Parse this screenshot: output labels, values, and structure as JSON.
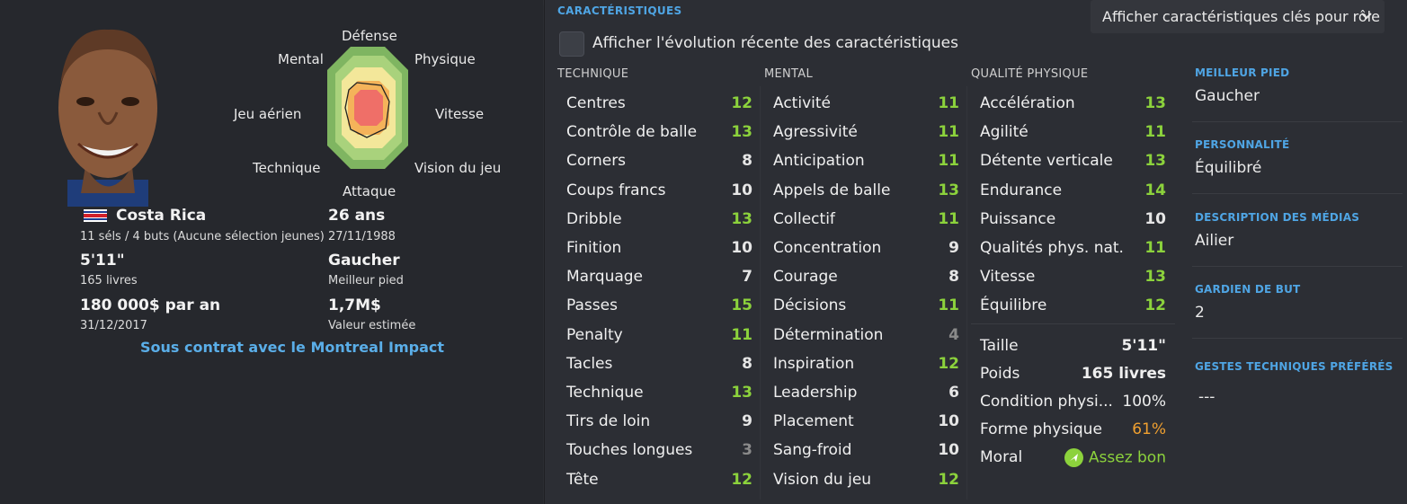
{
  "radar": {
    "labels": {
      "defense": "Défense",
      "physique": "Physique",
      "vitesse": "Vitesse",
      "vision": "Vision du jeu",
      "attaque": "Attaque",
      "technique": "Technique",
      "jeu_aerien": "Jeu aérien",
      "mental": "Mental"
    }
  },
  "player": {
    "nation": "Costa Rica",
    "caps": "11 séls / 4 buts (Aucune sélection jeunes)",
    "age": "26 ans",
    "birthdate": "27/11/1988",
    "height": "5'11\"",
    "weight": "165 livres",
    "foot": "Gaucher",
    "foot_label": "Meilleur pied",
    "wage": "180 000$ par an",
    "contract_end": "31/12/2017",
    "value": "1,7M$",
    "value_label": "Valeur estimée",
    "contract": "Sous contrat avec le Montreal Impact"
  },
  "header": {
    "section_title": "CARACTÉRISTIQUES",
    "dropdown": "Afficher caractéristiques clés pour rôle",
    "checkbox_label": "Afficher l'évolution récente des caractéristiques"
  },
  "columns": {
    "technique": "TECHNIQUE",
    "mental": "MENTAL",
    "physique": "QUALITÉ PHYSIQUE"
  },
  "technique": [
    {
      "name": "Centres",
      "value": "12",
      "color": "#8cd23c"
    },
    {
      "name": "Contrôle de balle",
      "value": "13",
      "color": "#8cd23c"
    },
    {
      "name": "Corners",
      "value": "8",
      "color": "#e6e6e6"
    },
    {
      "name": "Coups francs",
      "value": "10",
      "color": "#e6e6e6"
    },
    {
      "name": "Dribble",
      "value": "13",
      "color": "#8cd23c"
    },
    {
      "name": "Finition",
      "value": "10",
      "color": "#e6e6e6"
    },
    {
      "name": "Marquage",
      "value": "7",
      "color": "#e6e6e6"
    },
    {
      "name": "Passes",
      "value": "15",
      "color": "#8cd23c"
    },
    {
      "name": "Penalty",
      "value": "11",
      "color": "#8cd23c"
    },
    {
      "name": "Tacles",
      "value": "8",
      "color": "#e6e6e6"
    },
    {
      "name": "Technique",
      "value": "13",
      "color": "#8cd23c"
    },
    {
      "name": "Tirs de loin",
      "value": "9",
      "color": "#e6e6e6"
    },
    {
      "name": "Touches longues",
      "value": "3",
      "color": "#8a8a8a"
    },
    {
      "name": "Tête",
      "value": "12",
      "color": "#8cd23c"
    }
  ],
  "mental": [
    {
      "name": "Activité",
      "value": "11",
      "color": "#8cd23c"
    },
    {
      "name": "Agressivité",
      "value": "11",
      "color": "#8cd23c"
    },
    {
      "name": "Anticipation",
      "value": "11",
      "color": "#8cd23c"
    },
    {
      "name": "Appels de balle",
      "value": "13",
      "color": "#8cd23c"
    },
    {
      "name": "Collectif",
      "value": "11",
      "color": "#8cd23c"
    },
    {
      "name": "Concentration",
      "value": "9",
      "color": "#e6e6e6"
    },
    {
      "name": "Courage",
      "value": "8",
      "color": "#e6e6e6"
    },
    {
      "name": "Décisions",
      "value": "11",
      "color": "#8cd23c"
    },
    {
      "name": "Détermination",
      "value": "4",
      "color": "#8a8a8a"
    },
    {
      "name": "Inspiration",
      "value": "12",
      "color": "#8cd23c"
    },
    {
      "name": "Leadership",
      "value": "6",
      "color": "#e6e6e6"
    },
    {
      "name": "Placement",
      "value": "10",
      "color": "#e6e6e6"
    },
    {
      "name": "Sang-froid",
      "value": "10",
      "color": "#e6e6e6"
    },
    {
      "name": "Vision du jeu",
      "value": "12",
      "color": "#8cd23c"
    }
  ],
  "physical": [
    {
      "name": "Accélération",
      "value": "13",
      "color": "#8cd23c"
    },
    {
      "name": "Agilité",
      "value": "11",
      "color": "#8cd23c"
    },
    {
      "name": "Détente verticale",
      "value": "13",
      "color": "#8cd23c"
    },
    {
      "name": "Endurance",
      "value": "14",
      "color": "#8cd23c"
    },
    {
      "name": "Puissance",
      "value": "10",
      "color": "#e6e6e6"
    },
    {
      "name": "Qualités phys. nat.",
      "value": "11",
      "color": "#8cd23c"
    },
    {
      "name": "Vitesse",
      "value": "13",
      "color": "#8cd23c"
    },
    {
      "name": "Équilibre",
      "value": "12",
      "color": "#8cd23c"
    }
  ],
  "physical_info": {
    "taille_label": "Taille",
    "taille": "5'11\"",
    "poids_label": "Poids",
    "poids": "165 livres",
    "condition_label": "Condition physi...",
    "condition": "100%",
    "forme_label": "Forme physique",
    "forme": "61%",
    "moral_label": "Moral",
    "moral": "Assez bon"
  },
  "meta": {
    "meilleur_pied_label": "MEILLEUR PIED",
    "meilleur_pied": "Gaucher",
    "personnalite_label": "PERSONNALITÉ",
    "personnalite": "Équilibré",
    "medias_label": "DESCRIPTION DES MÉDIAS",
    "medias": "Ailier",
    "gardien_label": "GARDIEN DE BUT",
    "gardien": "2",
    "gestes_label": "GESTES TECHNIQUES PRÉFÉRÉS",
    "gestes": "---"
  }
}
